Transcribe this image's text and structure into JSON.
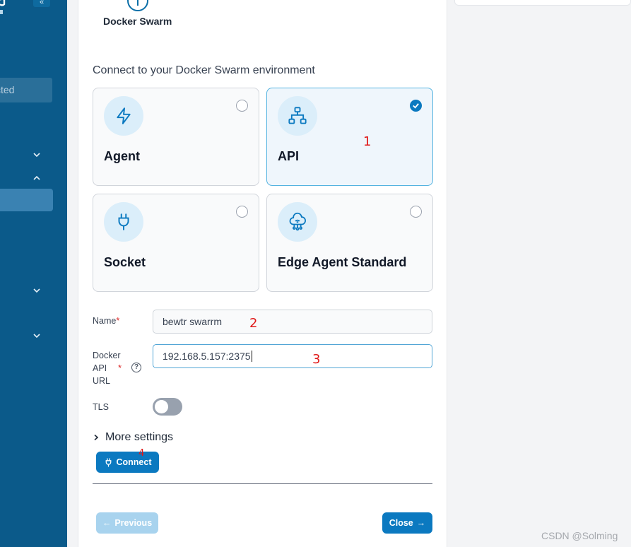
{
  "sidebar": {
    "environment_label": "cted",
    "collapse_glyph": "«"
  },
  "wizard": {
    "step_label": "Docker Swarm",
    "section_title": "Connect to your Docker Swarm environment",
    "options": [
      {
        "label": "Agent",
        "icon": "lightning-icon",
        "selected": false
      },
      {
        "label": "API",
        "icon": "network-icon",
        "selected": true
      },
      {
        "label": "Socket",
        "icon": "plug-icon",
        "selected": false
      },
      {
        "label": "Edge Agent Standard",
        "icon": "cloud-icon",
        "selected": false
      }
    ]
  },
  "form": {
    "name_label": "Name",
    "name_value": "bewtr swarrm",
    "url_label_1": "Docker",
    "url_label_2": "API",
    "url_label_3": "URL",
    "url_value": "192.168.5.157:2375",
    "tls_label": "TLS",
    "tls_enabled": false,
    "more_settings_label": "More settings",
    "connect_label": "Connect"
  },
  "footer": {
    "previous_label": "Previous",
    "close_label": "Close"
  },
  "annotations": [
    "1",
    "2",
    "3",
    "4"
  ],
  "watermark": "CSDN @Solming",
  "colors": {
    "sidebar": "#0b5a8a",
    "primary": "#0b79c0",
    "selected_border": "#54b3e0",
    "annotation": "#e01818"
  }
}
